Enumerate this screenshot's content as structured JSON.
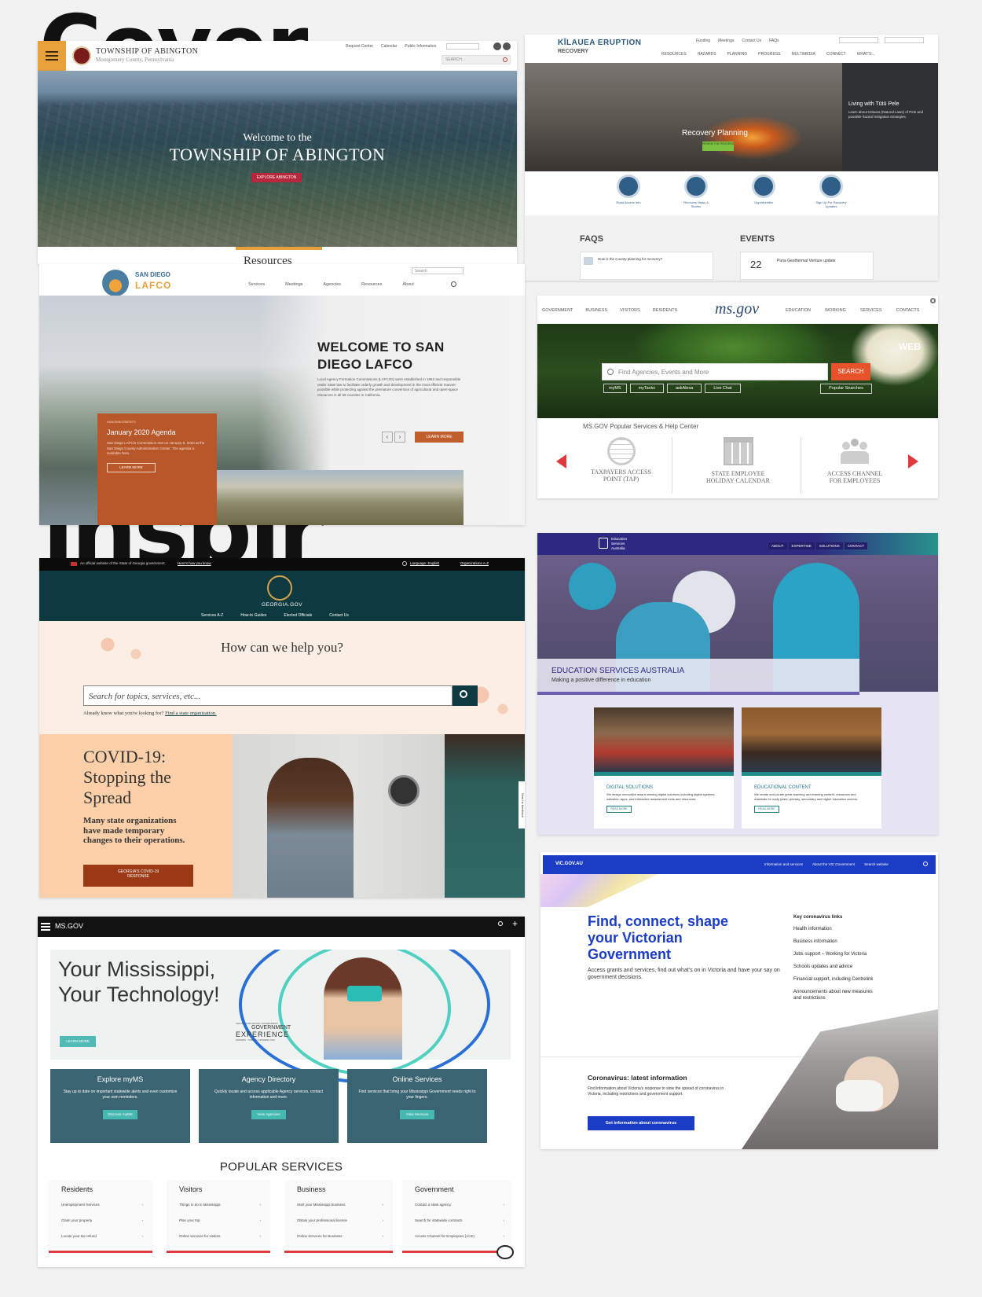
{
  "background_words": {
    "top": "Cover",
    "middle": "inspir"
  },
  "abington": {
    "title": "TOWNSHIP OF ABINGTON",
    "subtitle": "Montgomery County, Pennsylvania",
    "util_links": [
      "Request Center",
      "Calendar",
      "Public Information"
    ],
    "search_placeholder": "SEARCH...",
    "hero_welcome": "Welcome to the",
    "hero_title": "TOWNSHIP OF ABINGTON",
    "hero_button": "EXPLORE ABINGTON",
    "below": "Resources"
  },
  "kilauea": {
    "logo_line1": "KĪLAUEA ERUPTION",
    "logo_line2": "RECOVERY",
    "top_links": [
      "Funding",
      "Meetings",
      "Contact Us",
      "FAQs"
    ],
    "nav": [
      "RESOURCES",
      "HAZARDS",
      "PLANNING",
      "PROGRESS",
      "MULTIMEDIA",
      "CONNECT",
      "WHAT'S..."
    ],
    "hero_title": "Recovery Planning",
    "hero_button": "REVIEW THE PROCESS",
    "side_title": "Living with Tūtū Pele",
    "side_text": "Learn about Kīlauea (Natural Laws) of Pele and possible hazard mitigation strategies.",
    "icons": [
      {
        "label": "Road Access Info",
        "icon": "car-icon"
      },
      {
        "label": "Recovery News & Stories",
        "icon": "truck-icon"
      },
      {
        "label": "Opportunities",
        "icon": "hand-icon"
      },
      {
        "label": "Sign Up For Recovery Updates",
        "icon": "clipboard-icon"
      }
    ],
    "faqs_heading": "FAQS",
    "faq_item": "How is the County planning for recovery?",
    "events_heading": "EVENTS",
    "event_day": "22",
    "event_title": "Puna Geothermal Venture update"
  },
  "lafco": {
    "logo_line1": "SAN DIEGO",
    "logo_line2": "LAFCO",
    "nav": [
      "Services",
      "Meetings",
      "Agencies",
      "Resources",
      "About"
    ],
    "search_placeholder": "Search",
    "hero_title_1": "WELCOME TO SAN",
    "hero_title_2": "DIEGO LAFCO",
    "hero_text": "Local Agency Formation Commissions (LAFCOs) were established in 1963 and responsible under State law to facilitate orderly growth and development in the most efficient manner possible while protecting against the premature conversion of agricultural and open-space resources in all 58 counties in California.",
    "learn_more": "LEARN MORE",
    "announcement_tag": "ANNOUNCEMENTS",
    "announcement_title": "January 2020 Agenda",
    "announcement_text": "San Diego LAFCO Commission met on January 6, 2020 at the San Diego County Administration Center. The agenda is available here.",
    "announcement_button": "LEARN MORE"
  },
  "msgov_top": {
    "nav_left": [
      "GOVERNMENT",
      "BUSINESS",
      "VISITORS",
      "RESIDENTS"
    ],
    "logo": "ms.gov",
    "nav_right": [
      "EDUCATION",
      "WORKING",
      "SERVICES",
      "CONTACTS"
    ],
    "web_tag": "WEB",
    "search_placeholder": "Find Agencies, Events and More",
    "search_button": "SEARCH",
    "quick_links": [
      "myMS",
      "myTacks",
      "askAlexa",
      "Live Chat"
    ],
    "popular_searches": "Popular Searches",
    "help_heading": "MS.GOV Popular Services & Help Center",
    "services": [
      {
        "label_1": "TAXPAYERS ACCESS",
        "label_2": "POINT (TAP)",
        "icon": "globe-icon"
      },
      {
        "label_1": "STATE EMPLOYEE",
        "label_2": "HOLIDAY CALENDAR",
        "icon": "calendar-icon"
      },
      {
        "label_1": "ACCESS CHANNEL",
        "label_2": "FOR EMPLOYEES",
        "icon": "people-icon"
      }
    ]
  },
  "georgia": {
    "official_text": "An official website of the State of Georgia government.",
    "how_you_know": "Here's how you know",
    "language": "Language: English",
    "organizations": "Organizations A-Z",
    "logo_text": "GEORGIA.GOV",
    "nav": [
      "Services A-Z",
      "How-to Guides",
      "Elected Officials",
      "Contact Us"
    ],
    "hero_heading": "How can we help you?",
    "search_placeholder": "Search for topics, services, etc...",
    "already_know": "Already know what you're looking for?",
    "find_org": "Find a state organization.",
    "covid_title_1": "COVID-19:",
    "covid_title_2": "Stopping the",
    "covid_title_3": "Spread",
    "covid_text": "Many state organizations have made temporary changes to their operations.",
    "covid_button_1": "GEORGIA'S COVID-19",
    "covid_button_2": "RESPONSE",
    "feedback_tab": "Give us feedback"
  },
  "esa": {
    "logo_1": "Education",
    "logo_2": "Services",
    "logo_3": "Australia",
    "nav": [
      "ABOUT",
      "EXPERTISE",
      "SOLUTIONS",
      "CONTACT"
    ],
    "hero_title": "EDUCATION SERVICES AUSTRALIA",
    "hero_sub": "Making a positive difference in education",
    "card1_title": "DIGITAL SOLUTIONS",
    "card1_text": "We design innovative award winning digital solutions including digital systems, websites, apps, and interactive assessment tools and resources.",
    "card2_title": "EDUCATIONAL CONTENT",
    "card2_text": "We create and curate great teaching and learning content, resources and materials for early years, primary, secondary and higher education sectors.",
    "read_more": "READ MORE"
  },
  "vic": {
    "logo": "VIC.GOV.AU",
    "nav": [
      "Information and services",
      "About the VIC Government"
    ],
    "search_label": "Search website",
    "hero_title_1": "Find, connect, shape",
    "hero_title_2": "your Victorian",
    "hero_title_3": "Government",
    "hero_text": "Access grants and services, find out what's on in Victoria and have your say on government decisions.",
    "key_heading": "Key coronavirus links",
    "key_links": [
      "Health information",
      "Business information",
      "Jobs support – Working for Victoria",
      "Schools updates and advice",
      "Financial support, including Centrelink",
      "Announcements about new measures and restrictions"
    ],
    "corona_title": "Coronavirus: latest information",
    "corona_text": "Find information about Victoria's response to slow the spread of coronavirus in Victoria, including restrictions and government support.",
    "corona_button": "Get information about coronavirus"
  },
  "msgov_bottom": {
    "logo": "MS.GOV",
    "hero_line1": "Your Mississippi,",
    "hero_line2": "Your Technology!",
    "learn_more": "LEARN MORE",
    "award_small": "CENTER FOR DIGITAL GOVERNMENT",
    "award_main_1": "GOVERNMENT",
    "award_main_2": "EXPERIENCE",
    "award_sub": "AWARDS · OVERALL WINNER 2019",
    "cards": [
      {
        "title": "Explore myMS",
        "text": "Stay up to date on important statewide alerts and even customize your own reminders.",
        "button": "Discover myMS"
      },
      {
        "title": "Agency Directory",
        "text": "Quickly locate and access applicable Agency services, contact information and more.",
        "button": "View Agencies"
      },
      {
        "title": "Online Services",
        "text": "Find services that bring your Mississippi Government needs right to your fingers.",
        "button": "View Services"
      }
    ],
    "popular_heading": "POPULAR SERVICES",
    "columns": [
      {
        "title": "Residents",
        "items": [
          "Unemployment Services",
          "Claim your property",
          "Locate your tax refund"
        ]
      },
      {
        "title": "Visitors",
        "items": [
          "Things to do in Mississippi",
          "Plan your trip",
          "Online services for visitors"
        ]
      },
      {
        "title": "Business",
        "items": [
          "Start your Mississippi business",
          "Obtain your professional license",
          "Online Services for Business"
        ]
      },
      {
        "title": "Government",
        "items": [
          "Contact a state agency",
          "Search for statewide contracts",
          "Access Channel for Employees (ACE)"
        ]
      }
    ]
  }
}
